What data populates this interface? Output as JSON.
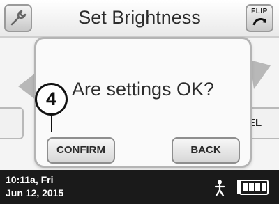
{
  "header": {
    "title": "Set Brightness",
    "settings_icon": "wrench-icon",
    "flip_label": "FLIP",
    "flip_icon": "curved-arrow-icon"
  },
  "background": {
    "cancel_partial": "EL"
  },
  "dialog": {
    "message": "Are settings OK?",
    "confirm_label": "CONFIRM",
    "back_label": "BACK"
  },
  "callout": {
    "number": "4"
  },
  "statusbar": {
    "time": "10:11a, Fri",
    "date": "Jun 12, 2015",
    "person_icon": "person-icon",
    "battery_icon": "battery-full-icon"
  },
  "colors": {
    "statusbar_bg": "#1a1a1a",
    "dialog_border": "#b4b4b4"
  }
}
